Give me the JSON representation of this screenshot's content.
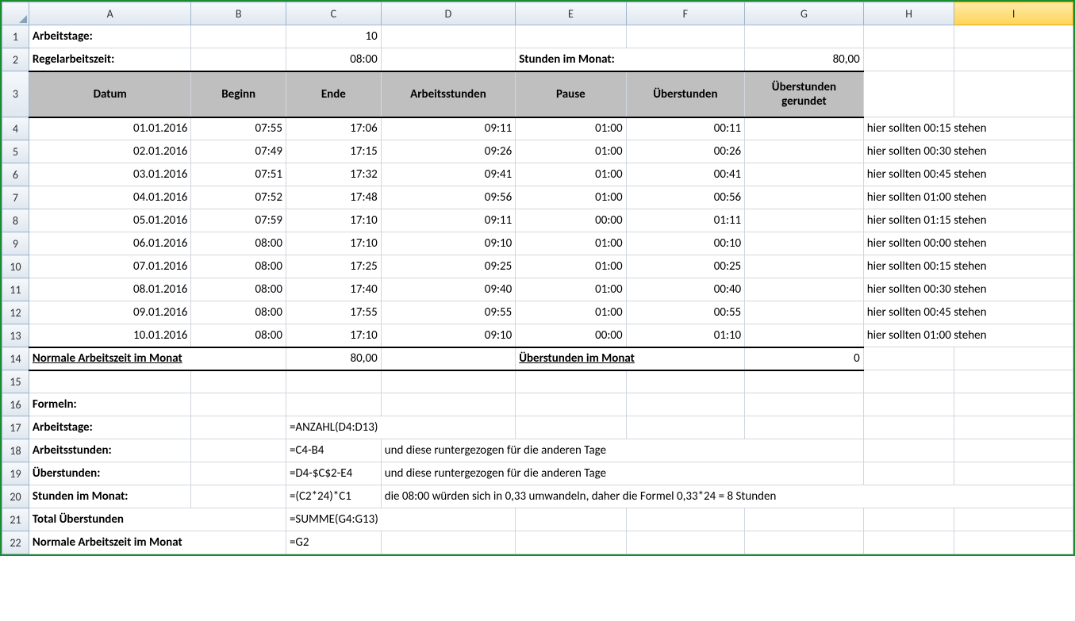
{
  "columns": [
    "A",
    "B",
    "C",
    "D",
    "E",
    "F",
    "G",
    "H",
    "I"
  ],
  "rows_shown": 22,
  "active_column": "I",
  "labels": {
    "arbeitstage": "Arbeitstage:",
    "regelarbeitszeit": "Regelarbeitszeit:",
    "stunden_im_monat": "Stunden im Monat:",
    "normale_arbeitszeit": "Normale Arbeitszeit im Monat",
    "ueberstunden_im_monat": "Überstunden im Monat",
    "formeln": "Formeln:",
    "arbeitsstunden": "Arbeitsstunden:",
    "ueberstunden": "Überstunden:",
    "total_ueberstunden": "Total Überstunden"
  },
  "values": {
    "arbeitstage": "10",
    "regelarbeitszeit": "08:00",
    "stunden_im_monat": "80,00",
    "normale_arbeitszeit_value": "80,00",
    "ueberstunden_im_monat_value": "0"
  },
  "headers": {
    "datum": "Datum",
    "beginn": "Beginn",
    "ende": "Ende",
    "arbeitsstunden": "Arbeitsstunden",
    "pause": "Pause",
    "ueberstunden": "Überstunden",
    "ueberstunden_gerundet": "Überstunden gerundet"
  },
  "data_rows": [
    {
      "datum": "01.01.2016",
      "beginn": "07:55",
      "ende": "17:06",
      "arbeitsstunden": "09:11",
      "pause": "01:00",
      "ueberstunden": "00:11",
      "note": "hier sollten 00:15 stehen"
    },
    {
      "datum": "02.01.2016",
      "beginn": "07:49",
      "ende": "17:15",
      "arbeitsstunden": "09:26",
      "pause": "01:00",
      "ueberstunden": "00:26",
      "note": "hier sollten 00:30 stehen"
    },
    {
      "datum": "03.01.2016",
      "beginn": "07:51",
      "ende": "17:32",
      "arbeitsstunden": "09:41",
      "pause": "01:00",
      "ueberstunden": "00:41",
      "note": "hier sollten 00:45 stehen"
    },
    {
      "datum": "04.01.2016",
      "beginn": "07:52",
      "ende": "17:48",
      "arbeitsstunden": "09:56",
      "pause": "01:00",
      "ueberstunden": "00:56",
      "note": "hier sollten 01:00 stehen"
    },
    {
      "datum": "05.01.2016",
      "beginn": "07:59",
      "ende": "17:10",
      "arbeitsstunden": "09:11",
      "pause": "00:00",
      "ueberstunden": "01:11",
      "note": "hier sollten 01:15 stehen"
    },
    {
      "datum": "06.01.2016",
      "beginn": "08:00",
      "ende": "17:10",
      "arbeitsstunden": "09:10",
      "pause": "01:00",
      "ueberstunden": "00:10",
      "note": "hier sollten 00:00 stehen"
    },
    {
      "datum": "07.01.2016",
      "beginn": "08:00",
      "ende": "17:25",
      "arbeitsstunden": "09:25",
      "pause": "01:00",
      "ueberstunden": "00:25",
      "note": "hier sollten 00:15 stehen"
    },
    {
      "datum": "08.01.2016",
      "beginn": "08:00",
      "ende": "17:40",
      "arbeitsstunden": "09:40",
      "pause": "01:00",
      "ueberstunden": "00:40",
      "note": "hier sollten 00:30 stehen"
    },
    {
      "datum": "09.01.2016",
      "beginn": "08:00",
      "ende": "17:55",
      "arbeitsstunden": "09:55",
      "pause": "01:00",
      "ueberstunden": "00:55",
      "note": "hier sollten 00:45 stehen"
    },
    {
      "datum": "10.01.2016",
      "beginn": "08:00",
      "ende": "17:10",
      "arbeitsstunden": "09:10",
      "pause": "00:00",
      "ueberstunden": "01:10",
      "note": "hier sollten 01:00 stehen"
    }
  ],
  "formulas": {
    "arbeitstage": "=ANZAHL(D4:D13)",
    "arbeitsstunden": "=C4-B4",
    "arbeitsstunden_note": "und diese runtergezogen für die anderen Tage",
    "ueberstunden": "=D4-$C$2-E4",
    "ueberstunden_note": "und diese runtergezogen für die anderen Tage",
    "stunden_im_monat": "=(C2*24)*C1",
    "stunden_im_monat_note": "die 08:00 würden sich in 0,33 umwandeln, daher die Formel 0,33*24 = 8 Stunden",
    "total_ueberstunden": "=SUMME(G4:G13)",
    "normale_arbeitszeit": "=G2"
  }
}
